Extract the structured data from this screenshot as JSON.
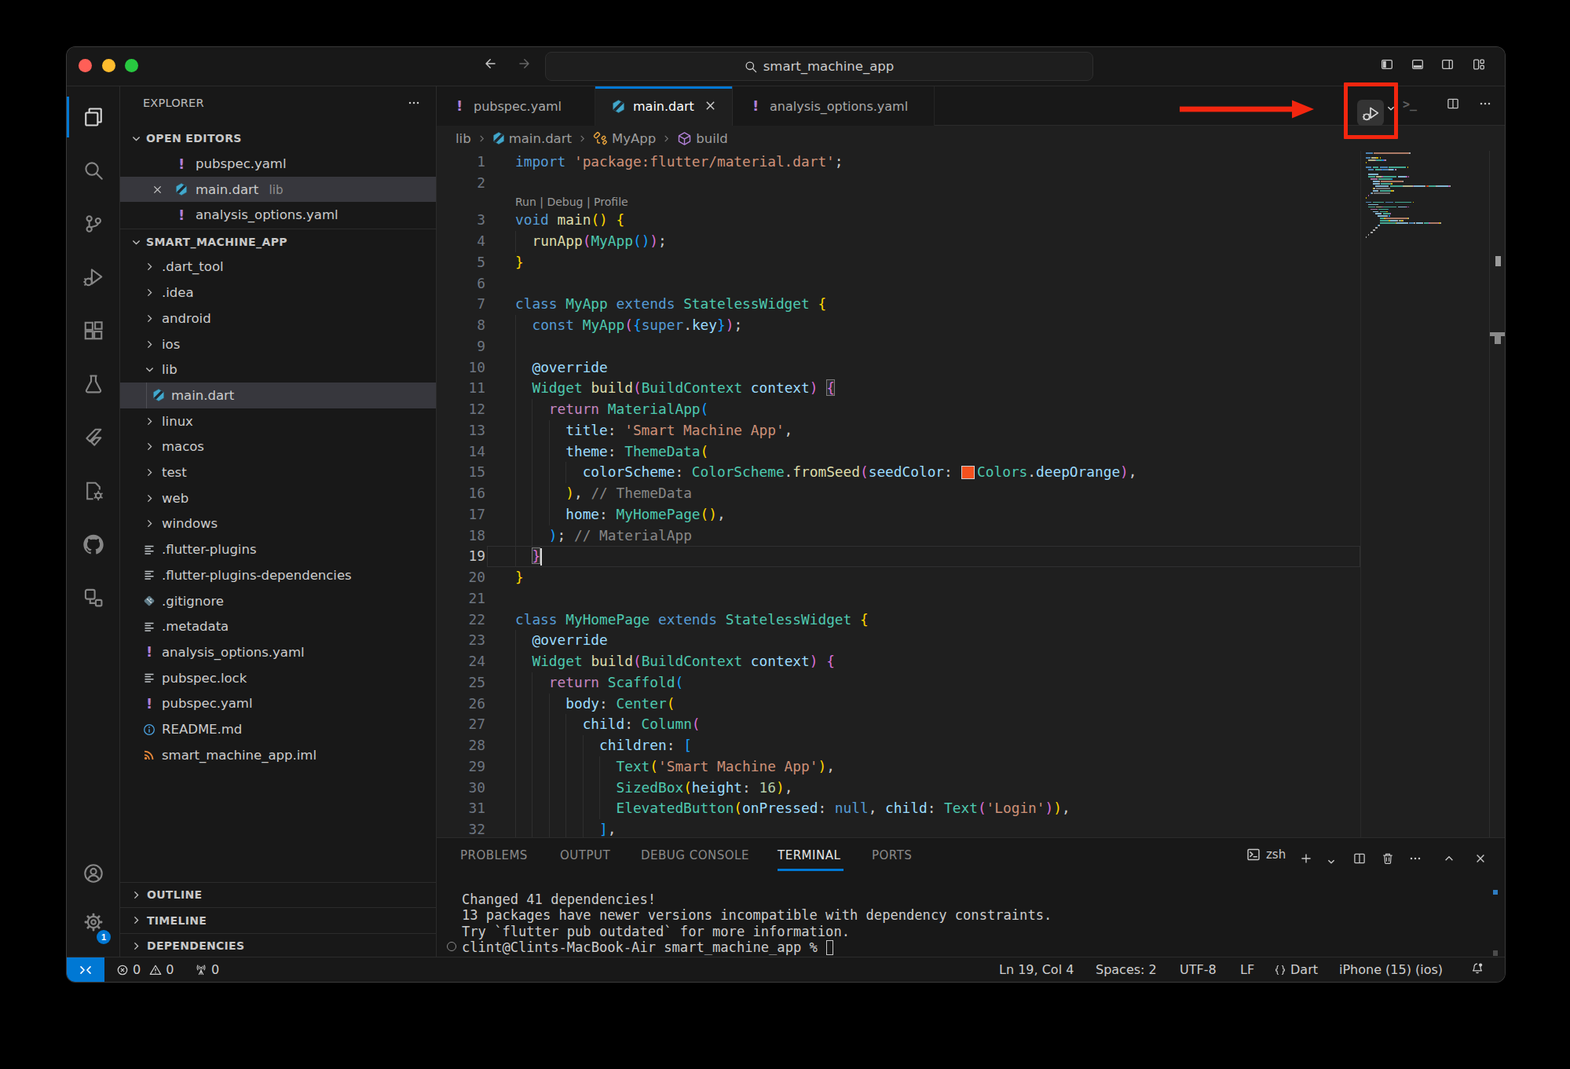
{
  "titlebar": {
    "search_label": "smart_machine_app",
    "back": "arrow-left",
    "forward": "arrow-right",
    "layout_icons": [
      "layout-sidebar-left",
      "layout-panel",
      "layout-sidebar-right",
      "layout-custom"
    ]
  },
  "activity_bar": {
    "items": [
      {
        "id": "explorer",
        "icon": "files",
        "active": true
      },
      {
        "id": "search",
        "icon": "search"
      },
      {
        "id": "source-control",
        "icon": "source-control"
      },
      {
        "id": "run-and-debug",
        "icon": "debug"
      },
      {
        "id": "extensions",
        "icon": "extensions"
      },
      {
        "id": "testing",
        "icon": "beaker"
      },
      {
        "id": "flutter",
        "icon": "flutter"
      },
      {
        "id": "dart-devtools",
        "icon": "file-gear"
      },
      {
        "id": "github",
        "icon": "github"
      },
      {
        "id": "remote-explorer",
        "icon": "remote-explorer"
      }
    ],
    "bottom_items": [
      {
        "id": "accounts",
        "icon": "account"
      },
      {
        "id": "settings",
        "icon": "gear",
        "badge": "1"
      }
    ]
  },
  "sidebar": {
    "title": "EXPLORER",
    "more": "ellipsis",
    "open_editors": {
      "label": "OPEN EDITORS",
      "items": [
        {
          "name": "pubspec.yaml",
          "icon": "yaml"
        },
        {
          "name": "main.dart",
          "icon": "dart",
          "detail": "lib",
          "selected": true,
          "close": true
        },
        {
          "name": "analysis_options.yaml",
          "icon": "yaml"
        }
      ]
    },
    "project": {
      "label": "SMART_MACHINE_APP",
      "items": [
        {
          "name": ".dart_tool",
          "kind": "folder"
        },
        {
          "name": ".idea",
          "kind": "folder"
        },
        {
          "name": "android",
          "kind": "folder"
        },
        {
          "name": "ios",
          "kind": "folder"
        },
        {
          "name": "lib",
          "kind": "folder",
          "expanded": true
        },
        {
          "name": "main.dart",
          "kind": "file",
          "icon": "dart",
          "indent": 1,
          "selected": true
        },
        {
          "name": "linux",
          "kind": "folder"
        },
        {
          "name": "macos",
          "kind": "folder"
        },
        {
          "name": "test",
          "kind": "folder"
        },
        {
          "name": "web",
          "kind": "folder"
        },
        {
          "name": "windows",
          "kind": "folder"
        },
        {
          "name": ".flutter-plugins",
          "kind": "file",
          "icon": "list"
        },
        {
          "name": ".flutter-plugins-dependencies",
          "kind": "file",
          "icon": "list"
        },
        {
          "name": ".gitignore",
          "kind": "file",
          "icon": "git"
        },
        {
          "name": ".metadata",
          "kind": "file",
          "icon": "list"
        },
        {
          "name": "analysis_options.yaml",
          "kind": "file",
          "icon": "yaml"
        },
        {
          "name": "pubspec.lock",
          "kind": "file",
          "icon": "list"
        },
        {
          "name": "pubspec.yaml",
          "kind": "file",
          "icon": "yaml"
        },
        {
          "name": "README.md",
          "kind": "file",
          "icon": "info"
        },
        {
          "name": "smart_machine_app.iml",
          "kind": "file",
          "icon": "rss"
        }
      ]
    },
    "bottom_sections": [
      "OUTLINE",
      "TIMELINE",
      "DEPENDENCIES"
    ]
  },
  "tabs": [
    {
      "name": "pubspec.yaml",
      "icon": "yaml"
    },
    {
      "name": "main.dart",
      "icon": "dart",
      "active": true,
      "close": true
    },
    {
      "name": "analysis_options.yaml",
      "icon": "yaml"
    }
  ],
  "editor_actions": {
    "run": "run-debug",
    "dropdown": "chevron-down",
    "run_terminal": "run-terminal",
    "split": "split-editor",
    "more": "ellipsis"
  },
  "breadcrumbs": [
    {
      "label": "lib"
    },
    {
      "label": "main.dart",
      "icon": "dart"
    },
    {
      "label": "MyApp",
      "icon": "symbol-class"
    },
    {
      "label": "build",
      "icon": "symbol-method"
    }
  ],
  "editor": {
    "codelens": "Run | Debug | Profile",
    "cursor": {
      "line": 19,
      "col": 4
    },
    "current_line": 19,
    "swatch_color": "#f4511e",
    "colors": {
      "fg": "#cccccc",
      "kw": "#569cd6",
      "ctrl": "#c586c0",
      "type": "#4ec9b0",
      "fn": "#dcdcaa",
      "prop": "#9cdcfe",
      "str": "#ce9178",
      "num": "#b5cea8",
      "b1": "#ffd700",
      "b2": "#da70d6",
      "b3": "#179fff",
      "label": "#878787",
      "lens": "#999999"
    },
    "lines": [
      {
        "n": 1,
        "t": [
          [
            "import",
            "kw"
          ],
          [
            " ",
            "fg"
          ],
          [
            "'package:flutter/material.dart'",
            "str"
          ],
          [
            ";",
            "fg"
          ]
        ]
      },
      {
        "n": 2,
        "t": []
      },
      {
        "n": 3,
        "t": [
          [
            "void",
            "kw"
          ],
          [
            " ",
            "fg"
          ],
          [
            "main",
            "fn"
          ],
          [
            "(",
            "b1"
          ],
          [
            ")",
            "b1"
          ],
          [
            " ",
            "fg"
          ],
          [
            "{",
            "b1"
          ]
        ]
      },
      {
        "n": 4,
        "t": [
          [
            "  ",
            "fg"
          ],
          [
            "runApp",
            "fn"
          ],
          [
            "(",
            "b2"
          ],
          [
            "MyApp",
            "type"
          ],
          [
            "(",
            "b3"
          ],
          [
            ")",
            "b3"
          ],
          [
            ")",
            "b2"
          ],
          [
            ";",
            "fg"
          ]
        ]
      },
      {
        "n": 5,
        "t": [
          [
            "}",
            "b1"
          ]
        ]
      },
      {
        "n": 6,
        "t": []
      },
      {
        "n": 7,
        "t": [
          [
            "class",
            "kw"
          ],
          [
            " ",
            "fg"
          ],
          [
            "MyApp",
            "type"
          ],
          [
            " ",
            "fg"
          ],
          [
            "extends",
            "kw"
          ],
          [
            " ",
            "fg"
          ],
          [
            "StatelessWidget",
            "type"
          ],
          [
            " ",
            "fg"
          ],
          [
            "{",
            "b1"
          ]
        ]
      },
      {
        "n": 8,
        "t": [
          [
            "  ",
            "fg"
          ],
          [
            "const",
            "kw"
          ],
          [
            " ",
            "fg"
          ],
          [
            "MyApp",
            "type"
          ],
          [
            "(",
            "b2"
          ],
          [
            "{",
            "b3"
          ],
          [
            "super",
            "kw"
          ],
          [
            ".",
            "fg"
          ],
          [
            "key",
            "prop"
          ],
          [
            "}",
            "b3"
          ],
          [
            ")",
            "b2"
          ],
          [
            ";",
            "fg"
          ]
        ]
      },
      {
        "n": 9,
        "t": []
      },
      {
        "n": 10,
        "t": [
          [
            "  ",
            "fg"
          ],
          [
            "@override",
            "prop"
          ]
        ]
      },
      {
        "n": 11,
        "t": [
          [
            "  ",
            "fg"
          ],
          [
            "Widget",
            "type"
          ],
          [
            " ",
            "fg"
          ],
          [
            "build",
            "fn"
          ],
          [
            "(",
            "b2"
          ],
          [
            "BuildContext",
            "type"
          ],
          [
            " ",
            "fg"
          ],
          [
            "context",
            "prop"
          ],
          [
            ")",
            "b2"
          ],
          [
            " ",
            "fg"
          ],
          [
            "{",
            "b2",
            "m"
          ]
        ]
      },
      {
        "n": 12,
        "t": [
          [
            "    ",
            "fg"
          ],
          [
            "return",
            "ctrl"
          ],
          [
            " ",
            "fg"
          ],
          [
            "MaterialApp",
            "type"
          ],
          [
            "(",
            "b3"
          ]
        ]
      },
      {
        "n": 13,
        "t": [
          [
            "      ",
            "fg"
          ],
          [
            "title",
            "prop"
          ],
          [
            ": ",
            "fg"
          ],
          [
            "'Smart Machine App'",
            "str"
          ],
          [
            ",",
            "fg"
          ]
        ]
      },
      {
        "n": 14,
        "t": [
          [
            "      ",
            "fg"
          ],
          [
            "theme",
            "prop"
          ],
          [
            ": ",
            "fg"
          ],
          [
            "ThemeData",
            "type"
          ],
          [
            "(",
            "b1"
          ]
        ]
      },
      {
        "n": 15,
        "t": [
          [
            "        ",
            "fg"
          ],
          [
            "colorScheme",
            "prop"
          ],
          [
            ": ",
            "fg"
          ],
          [
            "ColorScheme",
            "type"
          ],
          [
            ".",
            "fg"
          ],
          [
            "fromSeed",
            "fn"
          ],
          [
            "(",
            "b2"
          ],
          [
            "seedColor",
            "prop"
          ],
          [
            ": ",
            "fg"
          ],
          [
            "sw",
            "swatch"
          ],
          [
            "Colors",
            "type"
          ],
          [
            ".",
            "fg"
          ],
          [
            "deepOrange",
            "prop"
          ],
          [
            ")",
            "b2"
          ],
          [
            ",",
            "fg"
          ]
        ]
      },
      {
        "n": 16,
        "t": [
          [
            "      ",
            "fg"
          ],
          [
            ")",
            "b1"
          ],
          [
            ", ",
            "fg"
          ],
          [
            "// ThemeData",
            "label"
          ]
        ]
      },
      {
        "n": 17,
        "t": [
          [
            "      ",
            "fg"
          ],
          [
            "home",
            "prop"
          ],
          [
            ": ",
            "fg"
          ],
          [
            "MyHomePage",
            "type"
          ],
          [
            "(",
            "b1"
          ],
          [
            ")",
            "b1"
          ],
          [
            ",",
            "fg"
          ]
        ]
      },
      {
        "n": 18,
        "t": [
          [
            "    ",
            "fg"
          ],
          [
            ")",
            "b3"
          ],
          [
            "; ",
            "fg"
          ],
          [
            "// MaterialApp",
            "label"
          ]
        ]
      },
      {
        "n": 19,
        "t": [
          [
            "  ",
            "fg"
          ],
          [
            "}",
            "b2",
            "m"
          ]
        ]
      },
      {
        "n": 20,
        "t": [
          [
            "}",
            "b1"
          ]
        ]
      },
      {
        "n": 21,
        "t": []
      },
      {
        "n": 22,
        "t": [
          [
            "class",
            "kw"
          ],
          [
            " ",
            "fg"
          ],
          [
            "MyHomePage",
            "type"
          ],
          [
            " ",
            "fg"
          ],
          [
            "extends",
            "kw"
          ],
          [
            " ",
            "fg"
          ],
          [
            "StatelessWidget",
            "type"
          ],
          [
            " ",
            "fg"
          ],
          [
            "{",
            "b1"
          ]
        ]
      },
      {
        "n": 23,
        "t": [
          [
            "  ",
            "fg"
          ],
          [
            "@override",
            "prop"
          ]
        ]
      },
      {
        "n": 24,
        "t": [
          [
            "  ",
            "fg"
          ],
          [
            "Widget",
            "type"
          ],
          [
            " ",
            "fg"
          ],
          [
            "build",
            "fn"
          ],
          [
            "(",
            "b2"
          ],
          [
            "BuildContext",
            "type"
          ],
          [
            " ",
            "fg"
          ],
          [
            "context",
            "prop"
          ],
          [
            ")",
            "b2"
          ],
          [
            " ",
            "fg"
          ],
          [
            "{",
            "b2"
          ]
        ]
      },
      {
        "n": 25,
        "t": [
          [
            "    ",
            "fg"
          ],
          [
            "return",
            "ctrl"
          ],
          [
            " ",
            "fg"
          ],
          [
            "Scaffold",
            "type"
          ],
          [
            "(",
            "b3"
          ]
        ]
      },
      {
        "n": 26,
        "t": [
          [
            "      ",
            "fg"
          ],
          [
            "body",
            "prop"
          ],
          [
            ": ",
            "fg"
          ],
          [
            "Center",
            "type"
          ],
          [
            "(",
            "b1"
          ]
        ]
      },
      {
        "n": 27,
        "t": [
          [
            "        ",
            "fg"
          ],
          [
            "child",
            "prop"
          ],
          [
            ": ",
            "fg"
          ],
          [
            "Column",
            "type"
          ],
          [
            "(",
            "b2"
          ]
        ]
      },
      {
        "n": 28,
        "t": [
          [
            "          ",
            "fg"
          ],
          [
            "children",
            "prop"
          ],
          [
            ": ",
            "fg"
          ],
          [
            "[",
            "b3"
          ]
        ]
      },
      {
        "n": 29,
        "t": [
          [
            "            ",
            "fg"
          ],
          [
            "Text",
            "type"
          ],
          [
            "(",
            "b1"
          ],
          [
            "'Smart Machine App'",
            "str"
          ],
          [
            ")",
            "b1"
          ],
          [
            ",",
            "fg"
          ]
        ]
      },
      {
        "n": 30,
        "t": [
          [
            "            ",
            "fg"
          ],
          [
            "SizedBox",
            "type"
          ],
          [
            "(",
            "b1"
          ],
          [
            "height",
            "prop"
          ],
          [
            ": ",
            "fg"
          ],
          [
            "16",
            "num"
          ],
          [
            ")",
            "b1"
          ],
          [
            ",",
            "fg"
          ]
        ]
      },
      {
        "n": 31,
        "t": [
          [
            "            ",
            "fg"
          ],
          [
            "ElevatedButton",
            "type"
          ],
          [
            "(",
            "b1"
          ],
          [
            "onPressed",
            "prop"
          ],
          [
            ": ",
            "fg"
          ],
          [
            "null",
            "kw"
          ],
          [
            ", ",
            "fg"
          ],
          [
            "child",
            "prop"
          ],
          [
            ": ",
            "fg"
          ],
          [
            "Text",
            "type"
          ],
          [
            "(",
            "b2"
          ],
          [
            "'Login'",
            "str"
          ],
          [
            ")",
            "b2"
          ],
          [
            ")",
            "b1"
          ],
          [
            ",",
            "fg"
          ]
        ]
      },
      {
        "n": 32,
        "t": [
          [
            "          ",
            "fg"
          ],
          [
            "]",
            "b3"
          ],
          [
            ",",
            "fg"
          ]
        ]
      }
    ],
    "minimap_extra": [
      "        ),",
      "      ),",
      "    );",
      "  }",
      "}"
    ]
  },
  "panel": {
    "tabs": [
      {
        "label": "PROBLEMS"
      },
      {
        "label": "OUTPUT"
      },
      {
        "label": "DEBUG CONSOLE"
      },
      {
        "label": "TERMINAL",
        "active": true
      },
      {
        "label": "PORTS"
      }
    ],
    "shell": "zsh"
  },
  "terminal": {
    "lines": [
      "Changed 41 dependencies!",
      "13 packages have newer versions incompatible with dependency constraints.",
      "Try `flutter pub outdated` for more information."
    ],
    "prompt": "clint@Clints-MacBook-Air smart_machine_app % "
  },
  "status_bar": {
    "errors": "0",
    "warnings": "0",
    "ports": "0",
    "right": [
      "Ln 19, Col 4",
      "Spaces: 2",
      "UTF-8",
      "LF",
      "Dart",
      "iPhone (15) (ios)"
    ]
  },
  "annotation": {
    "color": "#f3260f"
  }
}
